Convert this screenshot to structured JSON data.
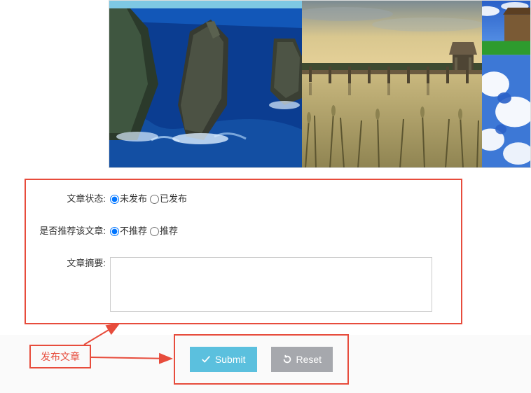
{
  "form": {
    "status": {
      "label": "文章状态:",
      "option1": "未发布",
      "option2": "已发布"
    },
    "recommend": {
      "label": "是否推荐该文章:",
      "option1": "不推荐",
      "option2": "推荐"
    },
    "summary": {
      "label": "文章摘要:"
    }
  },
  "annotation": {
    "publish_label": "发布文章"
  },
  "buttons": {
    "submit": "Submit",
    "reset": "Reset"
  }
}
